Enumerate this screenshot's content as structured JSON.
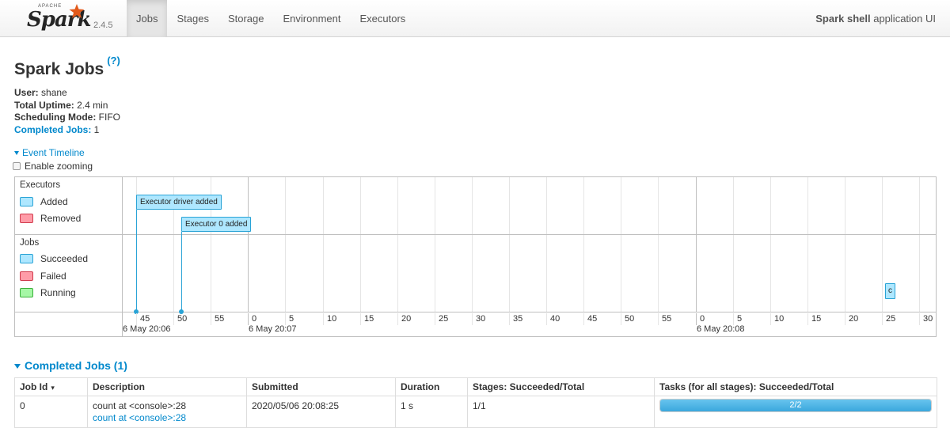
{
  "navbar": {
    "brand": {
      "apache": "APACHE",
      "spark": "Spark",
      "version": "2.4.5"
    },
    "tabs": [
      {
        "label": "Jobs",
        "active": true
      },
      {
        "label": "Stages",
        "active": false
      },
      {
        "label": "Storage",
        "active": false
      },
      {
        "label": "Environment",
        "active": false
      },
      {
        "label": "Executors",
        "active": false
      }
    ],
    "app_title_bold": "Spark shell",
    "app_title_rest": " application UI"
  },
  "page": {
    "title": "Spark Jobs",
    "help": "(?)"
  },
  "summary": {
    "user_label": "User:",
    "user_value": " shane",
    "uptime_label": "Total Uptime:",
    "uptime_value": " 2.4 min",
    "mode_label": "Scheduling Mode:",
    "mode_value": " FIFO",
    "completed_label": "Completed Jobs:",
    "completed_value": " 1"
  },
  "timeline": {
    "toggle_label": "Event Timeline",
    "zoom_label": "Enable zooming",
    "executors_group": "Executors",
    "jobs_group": "Jobs",
    "legend_executors": [
      {
        "label": "Added",
        "color": "#aee7ff",
        "border": "#29a3d6"
      },
      {
        "label": "Removed",
        "color": "#ff9ca8",
        "border": "#d03a4c"
      }
    ],
    "legend_jobs": [
      {
        "label": "Succeeded",
        "color": "#aee7ff",
        "border": "#29a3d6"
      },
      {
        "label": "Failed",
        "color": "#ff9ca8",
        "border": "#d03a4c"
      },
      {
        "label": "Running",
        "color": "#a6f7a6",
        "border": "#3ab03a"
      }
    ],
    "ticks": [
      "45",
      "50",
      "55",
      "0",
      "5",
      "10",
      "15",
      "20",
      "25",
      "30",
      "35",
      "40",
      "45",
      "50",
      "55",
      "0",
      "5",
      "10",
      "15",
      "20",
      "25",
      "30"
    ],
    "dates": [
      "6 May 20:06",
      "6 May 20:07",
      "6 May 20:08"
    ],
    "events": {
      "executor_driver": "Executor driver added",
      "executor_0": "Executor 0 added",
      "job_0": "c"
    }
  },
  "completed_jobs": {
    "section_label": "Completed Jobs (1)",
    "columns": [
      "Job Id",
      "Description",
      "Submitted",
      "Duration",
      "Stages: Succeeded/Total",
      "Tasks (for all stages): Succeeded/Total"
    ],
    "sort_indicator": "▾",
    "rows": [
      {
        "job_id": "0",
        "description": "count at <console>:28",
        "description_link": "count at <console>:28",
        "submitted": "2020/05/06 20:08:25",
        "duration": "1 s",
        "stages": "1/1",
        "tasks": "2/2",
        "tasks_fraction": 1.0
      }
    ]
  }
}
